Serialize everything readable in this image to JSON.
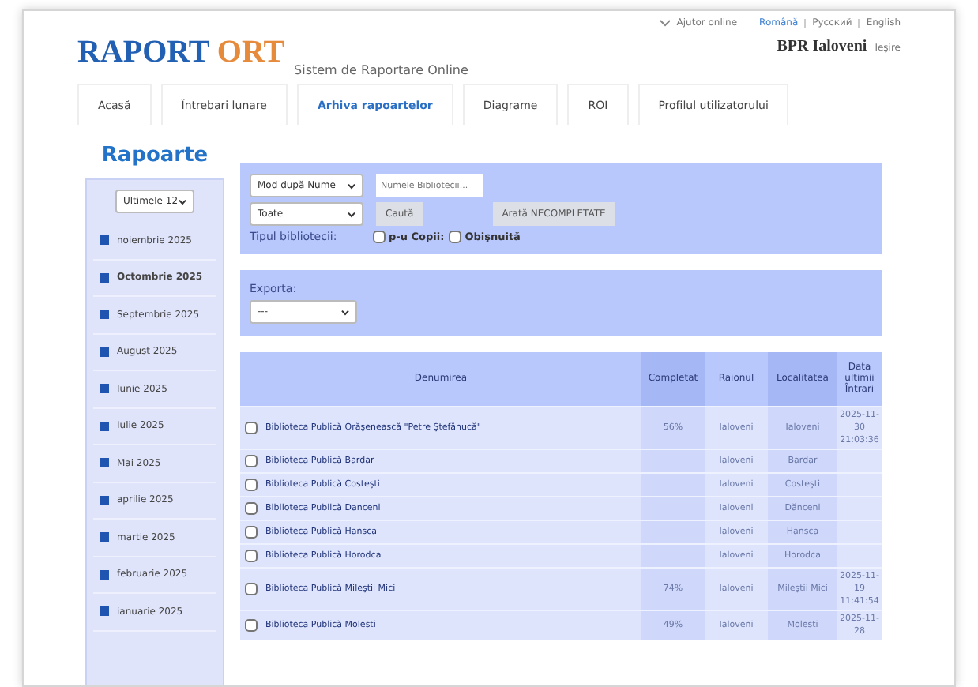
{
  "header": {
    "logo": {
      "part_1": "RAPORT",
      "part_2": "ORT"
    },
    "subtitle": "Sistem de Raportare Online",
    "help_link": "Ajutor online",
    "languages": [
      {
        "label": "Română",
        "selected": true
      },
      {
        "label": "Русский",
        "selected": false
      },
      {
        "label": "English",
        "selected": false
      }
    ],
    "user": "BPR Ialoveni",
    "logout": "Ieşire"
  },
  "tabs": [
    {
      "label": "Acasă",
      "selected": false
    },
    {
      "label": "Întrebari lunare",
      "selected": false
    },
    {
      "label": "Arhiva rapoartelor",
      "selected": true
    },
    {
      "label": "Diagrame",
      "selected": false
    },
    {
      "label": "ROI",
      "selected": false
    },
    {
      "label": "Profilul utilizatorului",
      "selected": false
    }
  ],
  "sidebar": {
    "title": "Rapoarte",
    "period_select": "Ultimele 12",
    "items": [
      {
        "label": "noiembrie 2025",
        "selected": false
      },
      {
        "label": "Octombrie 2025",
        "selected": true
      },
      {
        "label": "Septembrie 2025",
        "selected": false
      },
      {
        "label": "August 2025",
        "selected": false
      },
      {
        "label": "Iunie 2025",
        "selected": false
      },
      {
        "label": "Iulie 2025",
        "selected": false
      },
      {
        "label": "Mai 2025",
        "selected": false
      },
      {
        "label": "aprilie 2025",
        "selected": false
      },
      {
        "label": "martie 2025",
        "selected": false
      },
      {
        "label": "februarie 2025",
        "selected": false
      },
      {
        "label": "ianuarie 2025",
        "selected": false
      }
    ]
  },
  "filters": {
    "sort_select": "Mod după Nume",
    "name_field": {
      "placeholder": "Numele Bibliotecii..."
    },
    "status_select": "Toate",
    "search_button": "Caută",
    "incomplete_button": "Arată NECOMPLETATE",
    "library_type_label": "Tipul bibliotecii:",
    "types": [
      {
        "label": "p-u Copii:",
        "checked": false
      },
      {
        "label": "Obişnuită",
        "checked": false
      }
    ]
  },
  "export": {
    "label": "Exporta:",
    "select": "---"
  },
  "table": {
    "columns": [
      "Denumirea",
      "Completat",
      "Raionul",
      "Localitatea",
      "Data ultimii Întrari"
    ],
    "rows": [
      {
        "checked": false,
        "name": "Biblioteca Publică Orăşenească \"Petre Ştefănucă\"",
        "completed": "56%",
        "district": "Ialoveni",
        "locality": "Ialoveni",
        "last_entry": "2025-11-30 21:03:36"
      },
      {
        "checked": false,
        "name": "Biblioteca Publică Bardar",
        "district": "Ialoveni",
        "locality": "Bardar"
      },
      {
        "checked": false,
        "name": "Biblioteca Publică Costeşti",
        "district": "Ialoveni",
        "locality": "Costeşti"
      },
      {
        "checked": false,
        "name": "Biblioteca Publică Danceni",
        "district": "Ialoveni",
        "locality": "Dănceni"
      },
      {
        "checked": false,
        "name": "Biblioteca Publică Hansca",
        "district": "Ialoveni",
        "locality": "Hansca"
      },
      {
        "checked": false,
        "name": "Biblioteca Publică Horodca",
        "district": "Ialoveni",
        "locality": "Horodca"
      },
      {
        "checked": false,
        "name": "Biblioteca Publică Mileştii Mici",
        "completed": "74%",
        "district": "Ialoveni",
        "locality": "Mileştii Mici",
        "last_entry": "2025-11-19 11:41:54"
      },
      {
        "checked": false,
        "name": "Biblioteca Publică Molesti",
        "completed": "49%",
        "district": "Ialoveni",
        "locality": "Molesti",
        "last_entry": "2025-11-28"
      }
    ]
  }
}
